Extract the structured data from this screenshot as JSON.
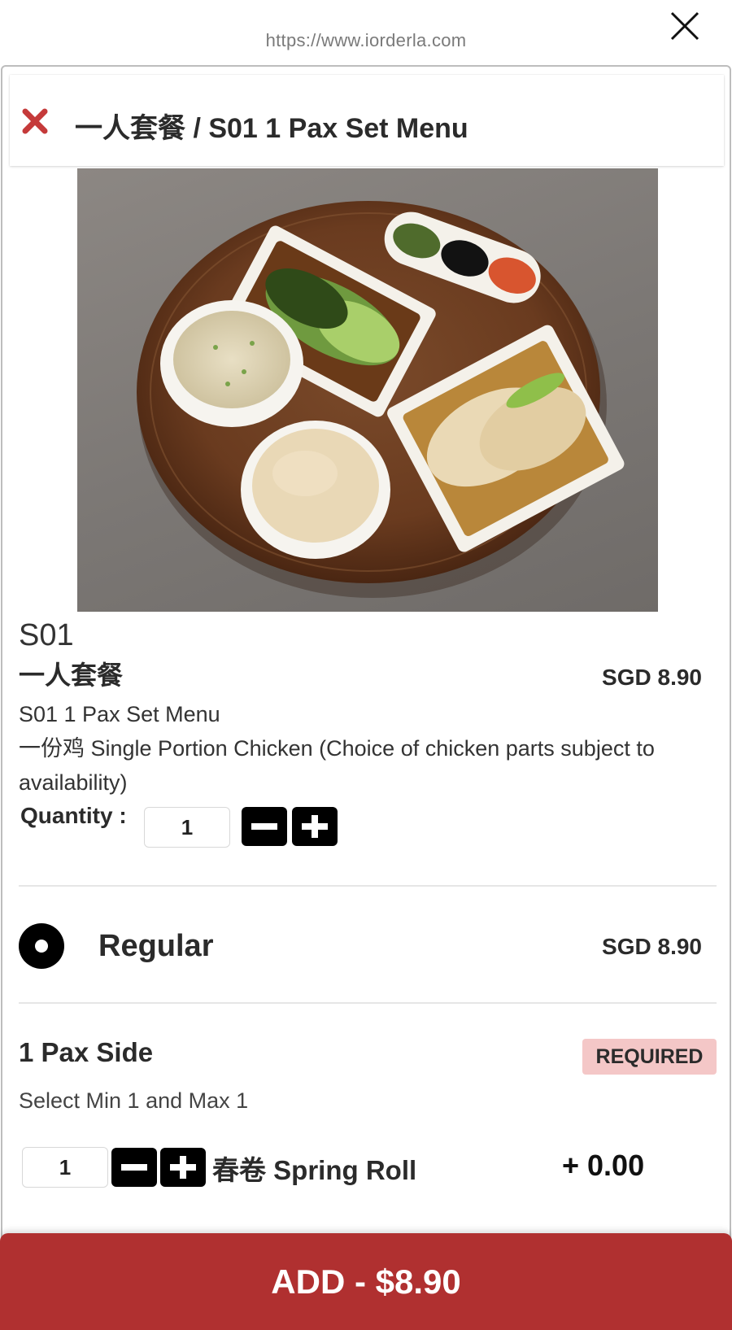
{
  "browser": {
    "url": "https://www.iorderla.com",
    "close_icon": "close-icon"
  },
  "modal": {
    "title": "一人套餐 / S01 1 Pax Set Menu",
    "close_icon": "close-x-icon",
    "accent_color": "#c53a3a"
  },
  "item": {
    "code": "S01",
    "name_cn": "一人套餐",
    "price": "SGD 8.90",
    "description_line1": "S01 1 Pax Set Menu",
    "description_line2": "一份鸡 Single Portion Chicken (Choice of chicken parts subject to availability)",
    "quantity_label": "Quantity :",
    "quantity_value": "1"
  },
  "variant": {
    "label": "Regular",
    "price": "SGD 8.90",
    "selected": true
  },
  "option_group": {
    "title": "1 Pax Side",
    "badge": "REQUIRED",
    "subtitle": "Select Min 1 and Max 1",
    "options": [
      {
        "quantity": "1",
        "label": "春卷 Spring Roll",
        "price": "+ 0.00"
      }
    ]
  },
  "footer": {
    "add_label": "ADD - $8.90",
    "bg_color": "#b03030"
  }
}
